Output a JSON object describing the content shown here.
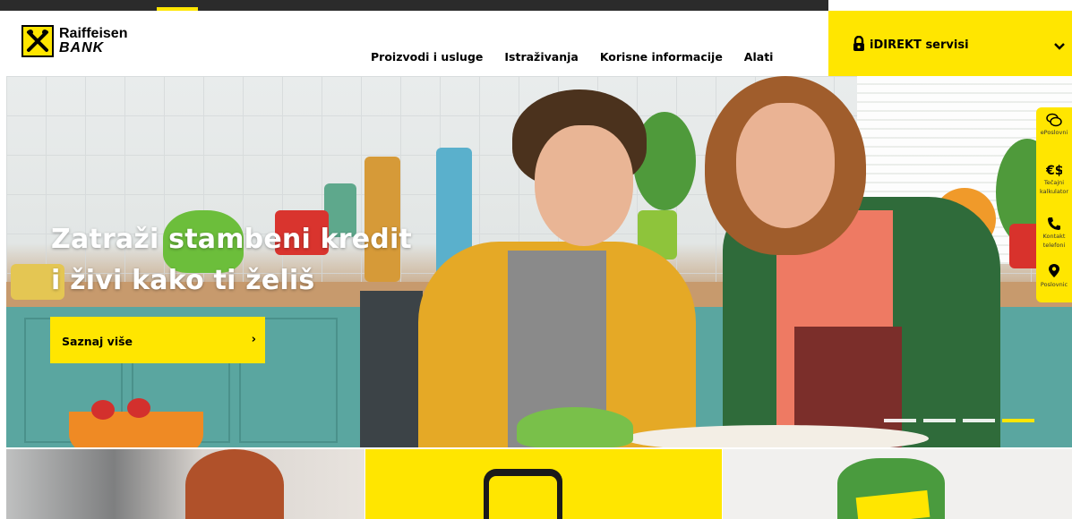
{
  "brand": {
    "name_line1": "Raiffeisen",
    "name_line2": "BANK",
    "yellow": "#ffe600"
  },
  "nav": {
    "items": [
      {
        "label": "Proizvodi i usluge"
      },
      {
        "label": "Istraživanja"
      },
      {
        "label": "Korisne informacije"
      },
      {
        "label": "Alati"
      }
    ]
  },
  "idirekt": {
    "label": "iDIREKT servisi",
    "icon": "lock-icon",
    "dropdown_icon": "chevron-down-icon"
  },
  "hero": {
    "headline_line1": "Zatraži stambeni kredit",
    "headline_line2": "i živi kako ti želiš",
    "cta_label": "Saznaj više",
    "cta_arrow": "›",
    "slides_total": 4,
    "active_slide": 4
  },
  "sidebar": {
    "items": [
      {
        "label_line1": "ePoslovni",
        "label_line2": "",
        "icon": "chat-bubbles-icon"
      },
      {
        "label_line1": "Tečajni",
        "label_line2": "kalkulator",
        "icon": "currency-exchange-icon"
      },
      {
        "label_line1": "Kontakt",
        "label_line2": "telefoni",
        "icon": "phone-icon"
      },
      {
        "label_line1": "Poslovnic",
        "label_line2": "",
        "icon": "location-pin-icon"
      }
    ]
  }
}
